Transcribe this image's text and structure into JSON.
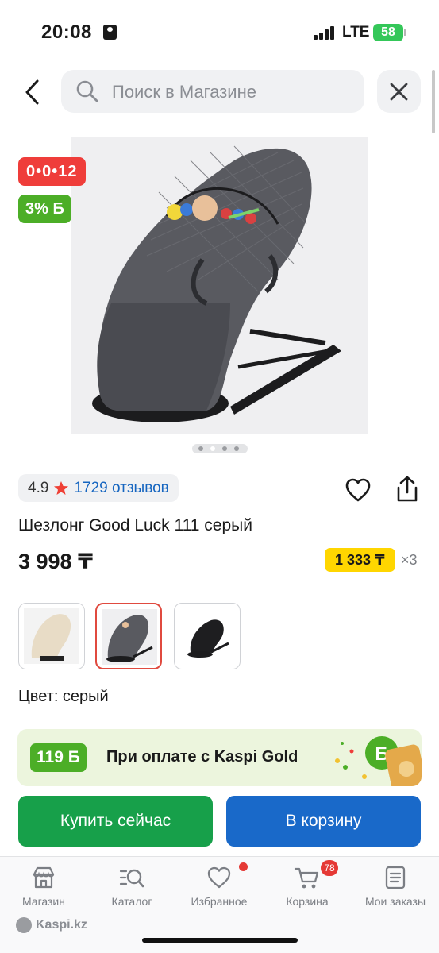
{
  "status_bar": {
    "time": "20:08",
    "network": "LTE",
    "battery": "58"
  },
  "search": {
    "placeholder": "Поиск в Магазине"
  },
  "badges": {
    "timer": "0•0•12",
    "bonus": "3% Б"
  },
  "product": {
    "rating": "4.9",
    "reviews": "1729 отзывов",
    "title": "Шезлонг Good Luck 111 серый",
    "price": "3 998 ₸",
    "installment_price": "1 333 ₸",
    "installment_count": "×3",
    "color_label": "Цвет: серый",
    "image_index": 2,
    "image_count": 4
  },
  "variants": [
    {
      "color": "beige",
      "selected": false
    },
    {
      "color": "grey",
      "selected": true
    },
    {
      "color": "black",
      "selected": false
    }
  ],
  "gold_banner": {
    "bonus": "119 Б",
    "text": "При оплате с Kaspi Gold"
  },
  "actions": {
    "buy_now": "Купить сейчас",
    "add_to_cart": "В корзину"
  },
  "tabs": [
    {
      "label": "Магазин",
      "icon": "shop-icon"
    },
    {
      "label": "Каталог",
      "icon": "catalog-search-icon"
    },
    {
      "label": "Избранное",
      "icon": "heart-icon"
    },
    {
      "label": "Корзина",
      "icon": "cart-icon",
      "count": "78"
    },
    {
      "label": "Мои заказы",
      "icon": "orders-icon"
    }
  ],
  "footer": {
    "brand": "Kaspi.kz"
  },
  "colors": {
    "green": "#17a04a",
    "blue": "#1969c9",
    "red": "#ef3d3a",
    "yellow": "#ffd600",
    "link": "#1565c0"
  }
}
